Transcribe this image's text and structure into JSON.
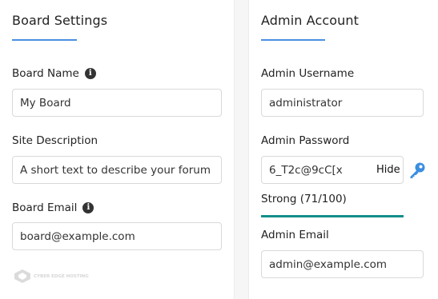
{
  "board_settings": {
    "title": "Board Settings",
    "board_name": {
      "label": "Board Name",
      "value": "My Board"
    },
    "site_description": {
      "label": "Site Description",
      "value": "A short text to describe your forum"
    },
    "board_email": {
      "label": "Board Email",
      "value": "board@example.com"
    }
  },
  "admin_account": {
    "title": "Admin Account",
    "username": {
      "label": "Admin Username",
      "value": "administrator"
    },
    "password": {
      "label": "Admin Password",
      "value": "6_T2c@9cC[x",
      "toggle_label": "Hide",
      "strength_text": "Strong (71/100)",
      "strength_score": 71,
      "strength_max": 100
    },
    "email": {
      "label": "Admin Email",
      "value": "admin@example.com"
    }
  },
  "watermark": {
    "text": "CYBER EDGE HOSTING"
  },
  "colors": {
    "accent_underline": "#4a90e2",
    "strength_bar": "#138f88",
    "key_icon": "#3b8ee0"
  },
  "icons": [
    "info-icon",
    "key-icon",
    "logo-icon"
  ]
}
